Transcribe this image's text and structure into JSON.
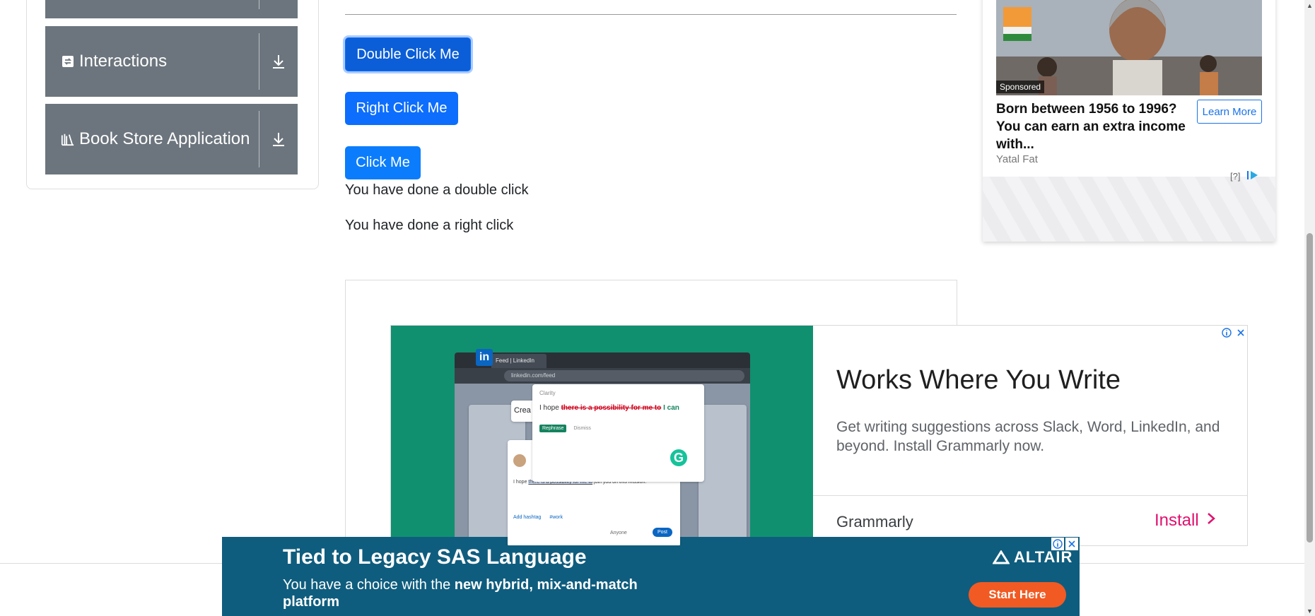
{
  "sidebar": {
    "groups": [
      {
        "label": "",
        "icon": "collapsed-group"
      },
      {
        "label": "Interactions",
        "icon": "interactions-icon"
      },
      {
        "label": "Book Store Application",
        "icon": "book-store-icon"
      }
    ]
  },
  "main": {
    "double_click_label": "Double Click Me",
    "right_click_label": "Right Click Me",
    "click_label": "Click Me",
    "double_click_message": "You have done a double click",
    "right_click_message": "You have done a right click"
  },
  "grammarly_ad": {
    "title": "Works Where You Write",
    "description": "Get writing suggestions across Slack, Word, LinkedIn, and beyond. Install Grammarly now.",
    "brand": "Grammarly",
    "cta": "Install",
    "mock": {
      "tab_title": "Feed | LinkedIn",
      "url": "linkedin.com/feed",
      "suggestion_prefix": "I hope",
      "suggestion_strike": "there is a possibility for me to",
      "suggestion_replacement": "I can",
      "tool_label": "Clarity",
      "rephrase": "Rephrase",
      "dismiss": "Dismiss",
      "create_label": "Crea",
      "post_text_prefix": "I hope ",
      "post_text_highlight": "there is a possibility for me to",
      "post_text_suffix": " join you on this mission.",
      "hashtag": "Add hashtag",
      "tag": "#work",
      "audience": "Anyone",
      "post_button": "Post",
      "logo_text": "in",
      "badge_text": "G"
    }
  },
  "sponsored": {
    "badge": "Sponsored",
    "headline": "Born between 1956 to 1996? You can earn an extra income with...",
    "source": "Yatal Fat",
    "cta": "Learn More",
    "help": "[?]"
  },
  "banner": {
    "title": "Tied to Legacy SAS Language",
    "subtitle_plain": "You have a choice with the ",
    "subtitle_bold": "new hybrid, mix-and-match platform",
    "brand": "ALTAIR",
    "cta": "Start Here"
  },
  "colors": {
    "primary": "#0d6efd",
    "sidebar_group": "#6c757d",
    "grammarly_green": "#10906f",
    "install_pink": "#e0116e",
    "banner_blue": "#0f5d7e",
    "banner_cta": "#f15a22"
  }
}
